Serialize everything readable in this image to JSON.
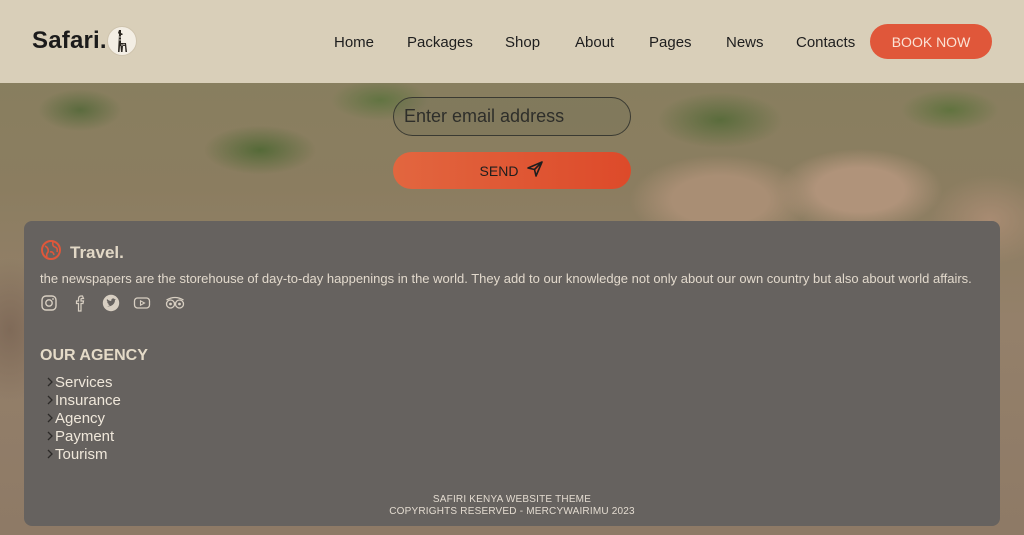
{
  "header": {
    "logo_text": "Safari.",
    "logo_icon": "giraffe-icon",
    "nav": [
      "Home",
      "Packages",
      "Shop",
      "About",
      "Pages",
      "News",
      "Contacts"
    ],
    "book_label": "BOOK NOW"
  },
  "newsletter": {
    "email_placeholder": "Enter email address",
    "send_label": "SEND",
    "send_icon": "paper-plane-icon"
  },
  "footer": {
    "brand_icon": "globe-icon",
    "brand_name": "Travel.",
    "description": "the newspapers are the storehouse of day-to-day happenings in the world. They add to our knowledge not only about our own country but also about world affairs.",
    "socials": [
      "instagram-icon",
      "facebook-icon",
      "twitter-icon",
      "youtube-icon",
      "tripadvisor-icon"
    ],
    "agency_title": "OUR AGENCY",
    "agency_links": [
      "Services",
      "Insurance",
      "Agency",
      "Payment",
      "Tourism"
    ],
    "copyright_line1": "SAFIRI KENYA WEBSITE THEME",
    "copyright_line2": "COPYRIGHTS RESERVED - MERCYWAIRIMU 2023"
  },
  "colors": {
    "header_bg": "#d9cfb9",
    "accent": "#e0573a",
    "footer_bg": "#66625f"
  }
}
